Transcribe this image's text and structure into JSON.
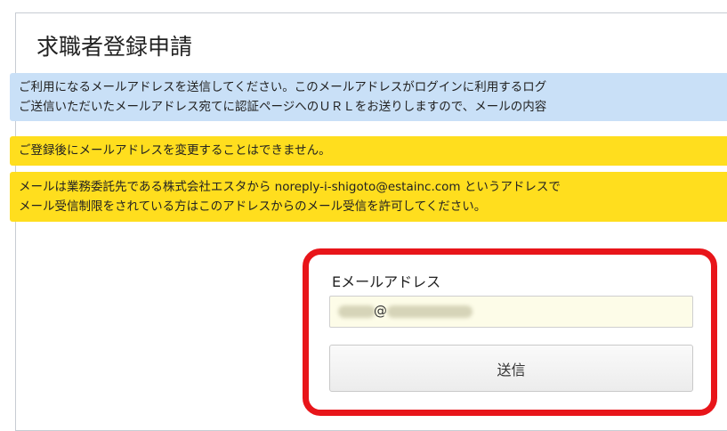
{
  "page": {
    "title": "求職者登録申請"
  },
  "notices": {
    "info_line1": "ご利用になるメールアドレスを送信してください。このメールアドレスがログインに利用するログ",
    "info_line2": "ご送信いただいたメールアドレス宛てに認証ページへのＵＲＬをお送りしますので、メールの内容",
    "warn_single": "ご登録後にメールアドレスを変更することはできません。",
    "warn_line1": "メールは業務委託先である株式会社エスタから noreply-i-shigoto@estainc.com というアドレスで",
    "warn_line2": "メール受信制限をされている方はこのアドレスからのメール受信を許可してください。"
  },
  "form": {
    "email_label": "Eメールアドレス",
    "email_value_visible": "@",
    "submit_label": "送信"
  },
  "colors": {
    "info_bg": "#c9e0f7",
    "warn_bg": "#ffde1e",
    "highlight_border": "#e8151a",
    "input_bg": "#fdfce8"
  }
}
